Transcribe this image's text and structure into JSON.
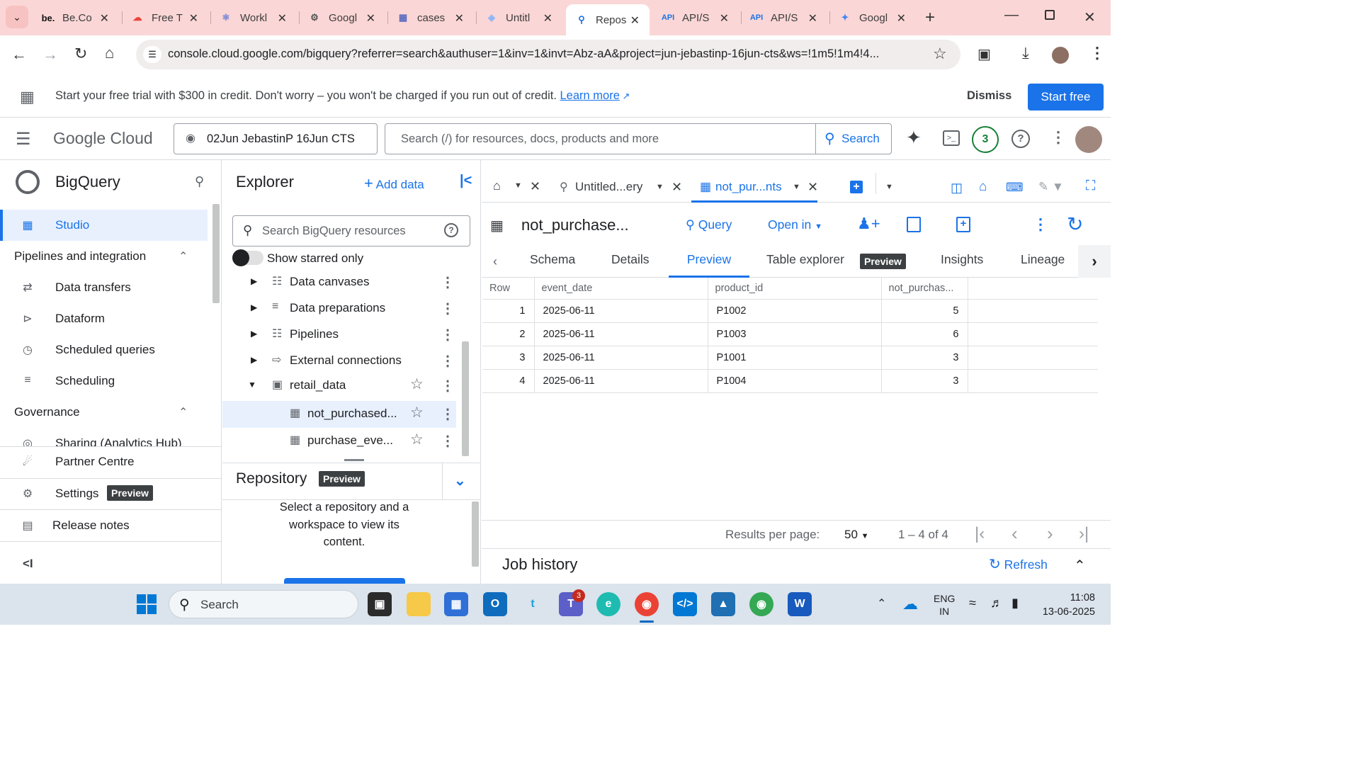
{
  "browser": {
    "tabs": [
      {
        "label": "Be.Co",
        "icon": "be"
      },
      {
        "label": "Free T",
        "icon": "cloud"
      },
      {
        "label": "Workl",
        "icon": "workload"
      },
      {
        "label": "Googl",
        "icon": "gear"
      },
      {
        "label": "cases",
        "icon": "table"
      },
      {
        "label": "Untitl",
        "icon": "lookerstudio"
      },
      {
        "label": "Repos",
        "icon": "bigquery",
        "active": true
      },
      {
        "label": "API/S",
        "icon": "api"
      },
      {
        "label": "API/S",
        "icon": "api"
      },
      {
        "label": "Googl",
        "icon": "gemini"
      }
    ],
    "url": "console.cloud.google.com/bigquery?referrer=search&authuser=1&inv=1&invt=Abz-aA&project=jun-jebastinp-16jun-cts&ws=!1m5!1m4!4..."
  },
  "banner": {
    "text": "Start your free trial with $300 in credit. Don't worry – you won't be charged if you run out of credit.",
    "link": "Learn more",
    "dismiss": "Dismiss",
    "start": "Start free"
  },
  "gcp": {
    "logo": "Google Cloud",
    "project": "02Jun JebastinP 16Jun CTS",
    "search_placeholder": "Search (/) for resources, docs, products and more",
    "search_button": "Search",
    "notifications": "3"
  },
  "nav": {
    "product": "BigQuery",
    "studio": "Studio",
    "section1": "Pipelines and integration",
    "items1": [
      "Data transfers",
      "Dataform",
      "Scheduled queries",
      "Scheduling"
    ],
    "section2": "Governance",
    "sharing": "Sharing (Analytics Hub)",
    "partner": "Partner Centre",
    "settings": "Settings",
    "settings_badge": "Preview",
    "release": "Release notes",
    "collapse": "<I"
  },
  "explorer": {
    "title": "Explorer",
    "add_data": "Add data",
    "search_placeholder": "Search BigQuery resources",
    "starred_toggle": "Show starred only",
    "items": [
      "Data canvases",
      "Data preparations",
      "Pipelines",
      "External connections"
    ],
    "dataset": "retail_data",
    "tables": [
      "not_purchased...",
      "purchase_eve..."
    ],
    "repository": "Repository",
    "repository_badge": "Preview",
    "repo_message": "Select a repository and a workspace to view its content."
  },
  "workspace": {
    "tabs": [
      "Untitled...ery",
      "not_pur...nts"
    ],
    "table_title": "not_purchase...",
    "query": "Query",
    "open_in": "Open in",
    "subtabs": [
      "Schema",
      "Details",
      "Preview",
      "Table explorer",
      "Insights",
      "Lineage"
    ],
    "subtab_badge": "Preview",
    "active_subtab": "Preview"
  },
  "grid": {
    "columns": [
      "Row",
      "event_date",
      "product_id",
      "not_purchas..."
    ],
    "rows": [
      [
        "1",
        "2025-06-11",
        "P1002",
        "5"
      ],
      [
        "2",
        "2025-06-11",
        "P1003",
        "6"
      ],
      [
        "3",
        "2025-06-11",
        "P1001",
        "3"
      ],
      [
        "4",
        "2025-06-11",
        "P1004",
        "3"
      ]
    ]
  },
  "pager": {
    "label": "Results per page:",
    "per_page": "50",
    "range": "1 – 4 of 4"
  },
  "job_history": {
    "title": "Job history",
    "refresh": "Refresh"
  },
  "taskbar": {
    "search": "Search",
    "lang1": "ENG",
    "lang2": "IN",
    "time": "11:08",
    "date": "13-06-2025",
    "teams_badge": "3"
  },
  "colors": {
    "accent": "#1a73e8",
    "tab_strip": "#fbd6d6",
    "selected_nav": "#e8f0fe"
  }
}
